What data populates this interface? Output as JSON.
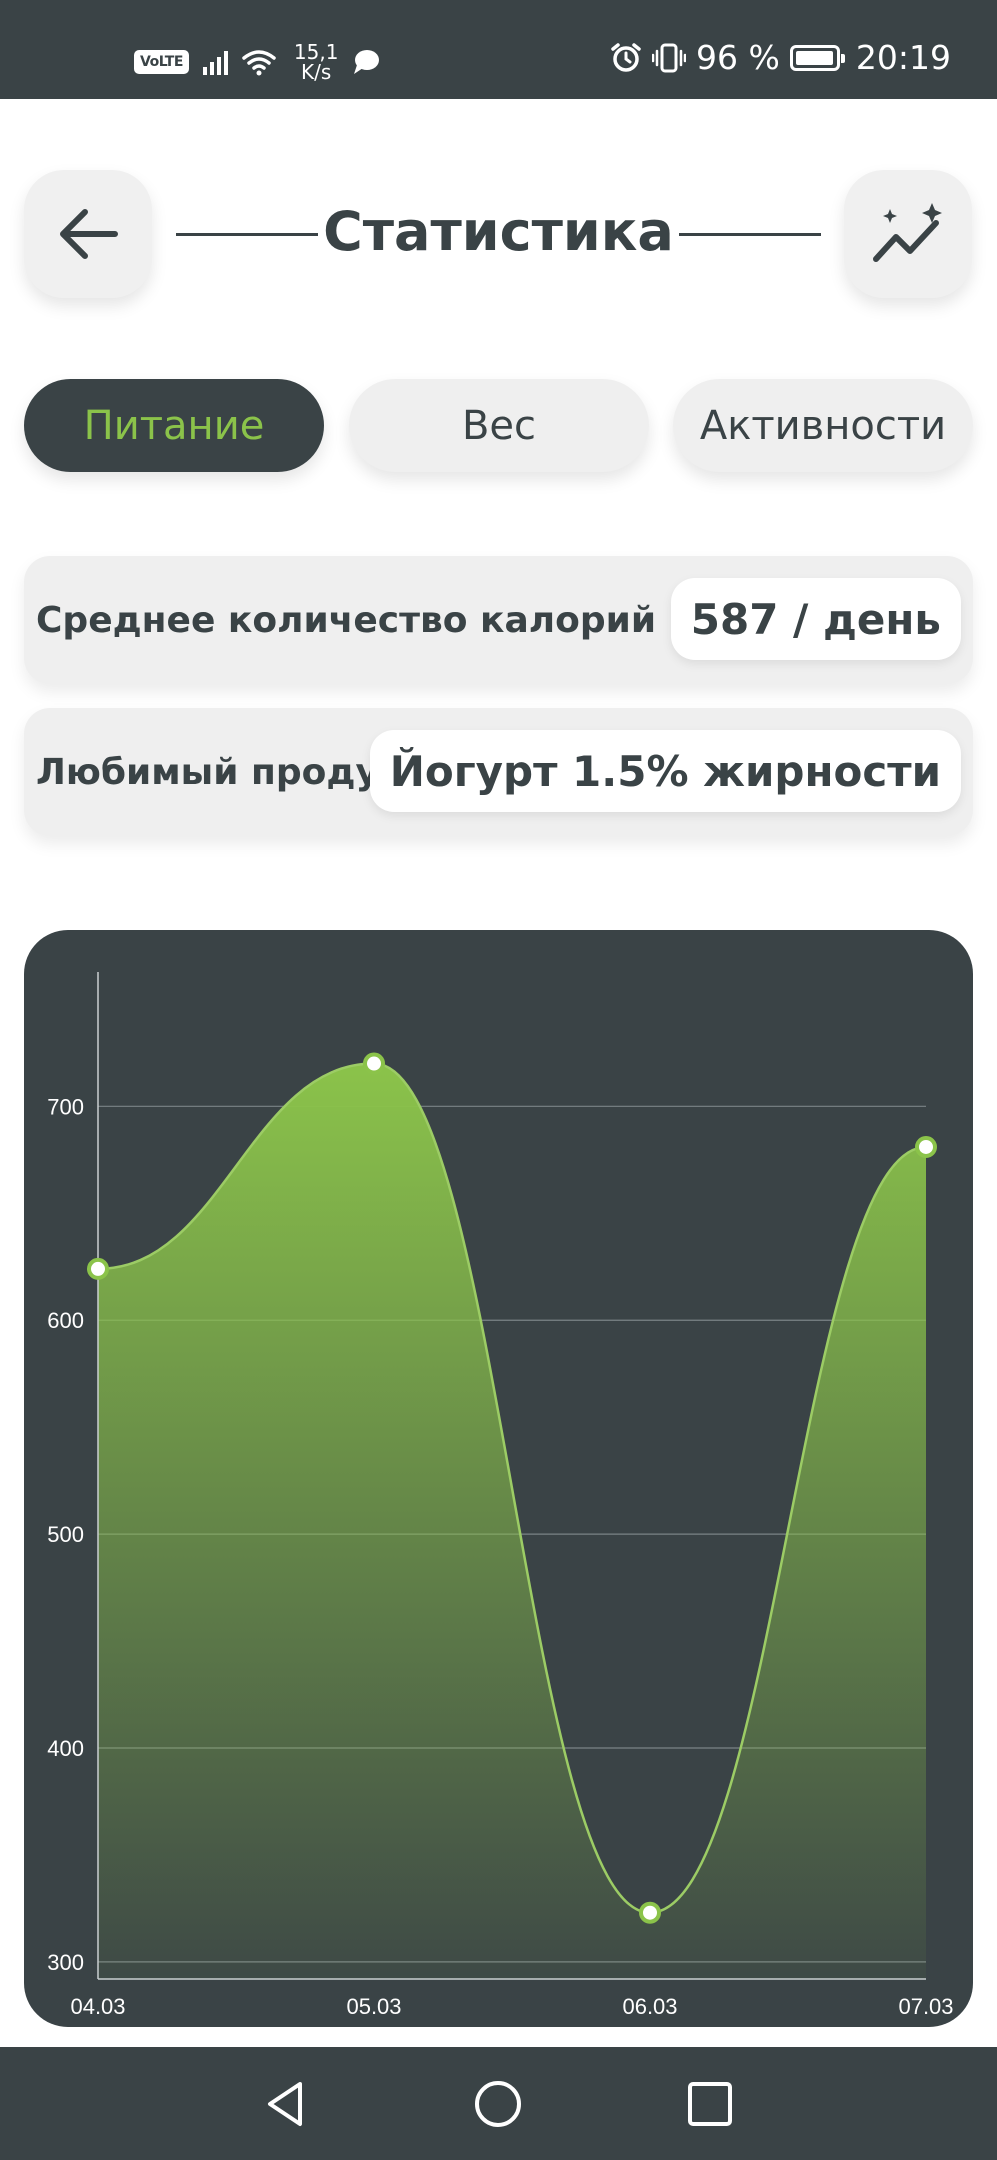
{
  "status_bar": {
    "volte": "VoLTE",
    "speed_value": "15,1",
    "speed_unit": "K/s",
    "battery": "96 %",
    "time": "20:19"
  },
  "header": {
    "title": "Статистика"
  },
  "tabs": [
    {
      "label": "Питание",
      "active": true
    },
    {
      "label": "Вес",
      "active": false
    },
    {
      "label": "Активности",
      "active": false
    }
  ],
  "cards": {
    "avg_calories": {
      "label": "Среднее количество калорий",
      "value": "587 / день"
    },
    "favorite_product": {
      "label": "Любимый продукт",
      "value": "Йогурт 1.5% жирности"
    }
  },
  "colors": {
    "dark": "#3a4346",
    "accent": "#8bc34a",
    "card_bg": "#efefef"
  },
  "icons": {
    "back": "arrow-left-icon",
    "stats": "sparkle-chart-icon",
    "nav_back": "triangle-back-icon",
    "nav_home": "circle-home-icon",
    "nav_recent": "square-recent-icon"
  },
  "chart_data": {
    "type": "area",
    "categories": [
      "04.03",
      "05.03",
      "06.03",
      "07.03"
    ],
    "values": [
      624,
      720,
      323,
      681
    ],
    "ylim": [
      292,
      760
    ],
    "yticks": [
      300,
      400,
      500,
      600,
      700
    ],
    "grid": true
  }
}
